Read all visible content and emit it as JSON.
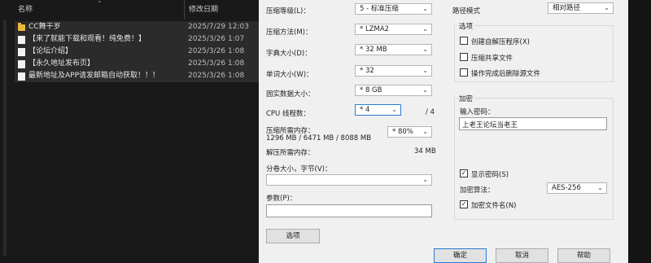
{
  "explorer": {
    "col_name": "名称",
    "col_date": "修改日期",
    "files": [
      {
        "type": "folder",
        "name": "CC舞干岁",
        "date": "2025/7/29 12:03"
      },
      {
        "type": "doc",
        "name": "【来了就能下载和观看！纯免费！】",
        "date": "2025/3/26 1:07"
      },
      {
        "type": "doc",
        "name": "【论坛介绍】",
        "date": "2025/3/26 1:08"
      },
      {
        "type": "doc",
        "name": "【永久地址发布页】",
        "date": "2025/3/26 1:08"
      },
      {
        "type": "doc",
        "name": "最新地址及APP请发邮箱自动获取！！！",
        "date": "2025/3/26 1:08"
      }
    ]
  },
  "dialog": {
    "level_label": "压缩等级(L)：",
    "level_value": "5 - 标准压缩",
    "method_label": "压缩方法(M)：",
    "method_value": "* LZMA2",
    "dict_label": "字典大小(D)：",
    "dict_value": "* 32 MB",
    "word_label": "单词大小(W)：",
    "word_value": "* 32",
    "solid_label": "固实数据大小：",
    "solid_value": "* 8 GB",
    "cpu_label": "CPU 线程数：",
    "cpu_value": "* 4",
    "cpu_max": "/ 4",
    "mem_label": "压缩所需内存：",
    "mem_detail": "1296 MB / 6471 MB / 8088 MB",
    "mem_value": "* 80%",
    "decomp_label": "解压所需内存：",
    "decomp_value": "34 MB",
    "split_label": "分卷大小，字节(V)：",
    "split_value": "",
    "params_label": "参数(P)：",
    "params_value": "",
    "options_button": "选项",
    "path_label": "路径模式",
    "path_value": "相对路径",
    "options_group": "选项",
    "opt_sfx": "创建自解压程序(X)",
    "opt_shared": "压缩共享文件",
    "opt_delete": "操作完成后删除源文件",
    "encrypt_group": "加密",
    "pwd_label": "输入密码：",
    "pwd_value": "上老王论坛当老王",
    "show_pwd": "显示密码(S)",
    "enc_method_label": "加密算法：",
    "enc_method_value": "AES-256",
    "enc_names": "加密文件名(N)",
    "ok": "确定",
    "cancel": "取消",
    "help": "帮助",
    "checkmark": "✓"
  }
}
